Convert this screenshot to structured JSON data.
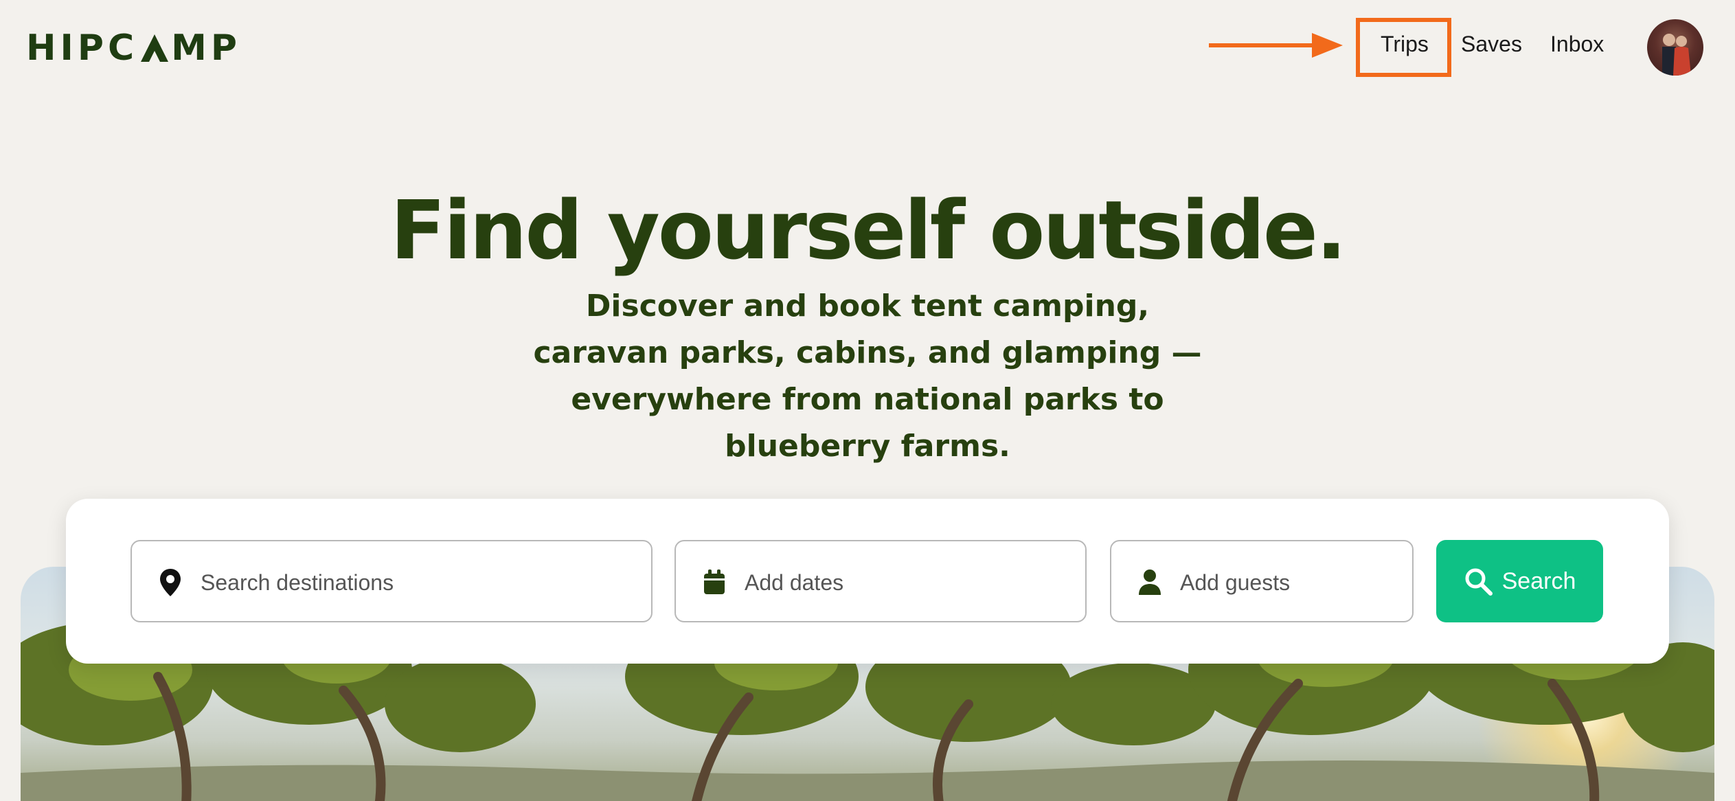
{
  "header": {
    "logo_text": "HIPCAMP",
    "nav": [
      {
        "label": "Trips"
      },
      {
        "label": "Saves"
      },
      {
        "label": "Inbox"
      }
    ],
    "highlight_color": "#f26a1b"
  },
  "hero": {
    "title": "Find yourself outside.",
    "subtitle": "Discover and book tent camping, caravan parks, cabins, and glamping — everywhere from national parks to blueberry farms."
  },
  "search": {
    "destination_placeholder": "Search destinations",
    "dates_placeholder": "Add dates",
    "guests_placeholder": "Add guests",
    "button_label": "Search",
    "button_color": "#0ec185"
  },
  "icons": {
    "destination": "map-pin-icon",
    "dates": "calendar-icon",
    "guests": "person-icon",
    "search": "magnifier-icon"
  }
}
